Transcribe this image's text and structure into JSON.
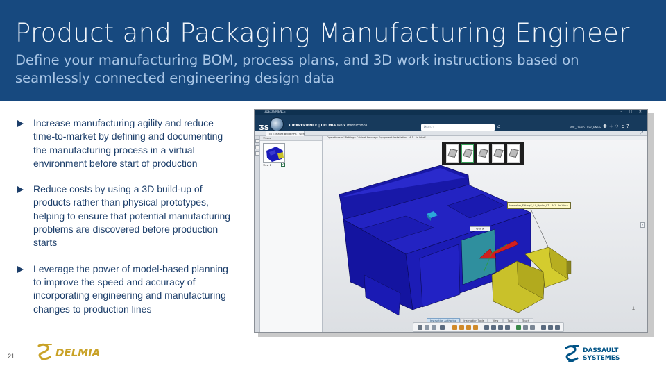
{
  "header": {
    "title": "Product and Packaging Manufacturing Engineer",
    "subtitle": "Define your  manufacturing BOM, process plans, and 3D work instructions based on seamlessly connected engineering design data"
  },
  "bullets": [
    "Increase manufacturing agility and reduce time-to-market by defining and documenting the manufacturing process in a virtual environment before start of production",
    "Reduce costs by using a 3D build-up of products rather than physical prototypes, helping to ensure that potential manufacturing problems are discovered before production starts",
    "Leverage the power of model-based planning to improve the speed and accuracy of incorporating engineering and manufacturing changes to production lines"
  ],
  "screenshot": {
    "window_title": "3DEXPERIENCE",
    "app_brand": "3DEXPERIENCE | DELMIA",
    "app_name": "Work Instructions",
    "search_placeholder": "Search",
    "user": "PRC_Demo User_BMFS",
    "doc_tab": "TR Exhaust Build PPR - Gen",
    "tree_header": "Views",
    "tree_item": "View 1",
    "operations_label": "Operations of 'Refridge Cabinet Smokeys Equipment Installation - A.1 - In Work'",
    "callout_text": "Icemaker_FittingS_LL_Hydrs_ST - A.1 - In Work",
    "section_tabs": [
      "Instruction Authoring",
      "Instruction Tools",
      "View",
      "Tools",
      "Touch"
    ],
    "active_tab": "Instruction Authoring"
  },
  "footer": {
    "page_number": "21",
    "delmia_logo_text": "DELMIA",
    "dassault_line1": "DASSAULT",
    "dassault_line2": "SYSTEMES"
  },
  "colors": {
    "header_bg": "#17497f",
    "body_text": "#1c3e6a",
    "brand_blue": "#005386",
    "model_blue": "#1a1ab8",
    "model_yellow": "#c9c12a"
  }
}
